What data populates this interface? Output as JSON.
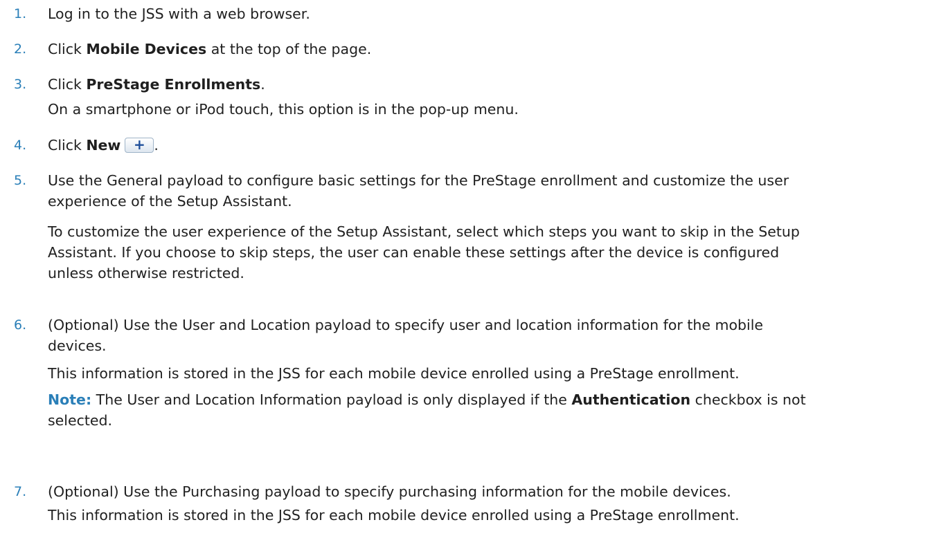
{
  "steps": [
    {
      "number": "1.",
      "text": "Log in to the JSS with a web browser."
    },
    {
      "number": "2.",
      "pre": "Click ",
      "bold": "Mobile Devices",
      "post": " at the top of the page."
    },
    {
      "number": "3.",
      "pre": "Click ",
      "bold": "PreStage Enrollments",
      "post": ".",
      "sub": "On a smartphone or iPod touch, this option is in the pop-up menu."
    },
    {
      "number": "4.",
      "pre": "Click ",
      "bold": "New",
      "button_glyph": "+",
      "post": "."
    },
    {
      "number": "5.",
      "line1": "Use the General payload to configure basic settings for the PreStage enrollment and customize the user",
      "line2": "experience of the Setup Assistant.",
      "para_line1": "To customize the user experience of the Setup Assistant, select which steps you want to skip in the Setup",
      "para_line2": "Assistant. If you choose to skip steps, the user can enable these settings after the device is configured",
      "para_line3": "unless otherwise restricted."
    },
    {
      "number": "6.",
      "line1": "(Optional) Use the User and Location payload to specify user and location information for the mobile",
      "line2": "devices.",
      "sub": "This information is stored in the JSS for each mobile device enrolled using a PreStage enrollment.",
      "note_label": "Note:",
      "note_pre": " The User and Location Information payload is only displayed if the ",
      "note_bold": "Authentication",
      "note_post": " checkbox is not",
      "note_line2": "selected."
    },
    {
      "number": "7.",
      "line1": "(Optional) Use the Purchasing payload to specify purchasing information for the mobile devices.",
      "sub": "This information is stored in the JSS for each mobile device enrolled using a PreStage enrollment."
    }
  ],
  "colors": {
    "accent": "#2a7fb8",
    "text": "#1f1f1f",
    "button_glyph": "#1f4f9a"
  },
  "icons": {
    "new_button": "plus-icon"
  }
}
